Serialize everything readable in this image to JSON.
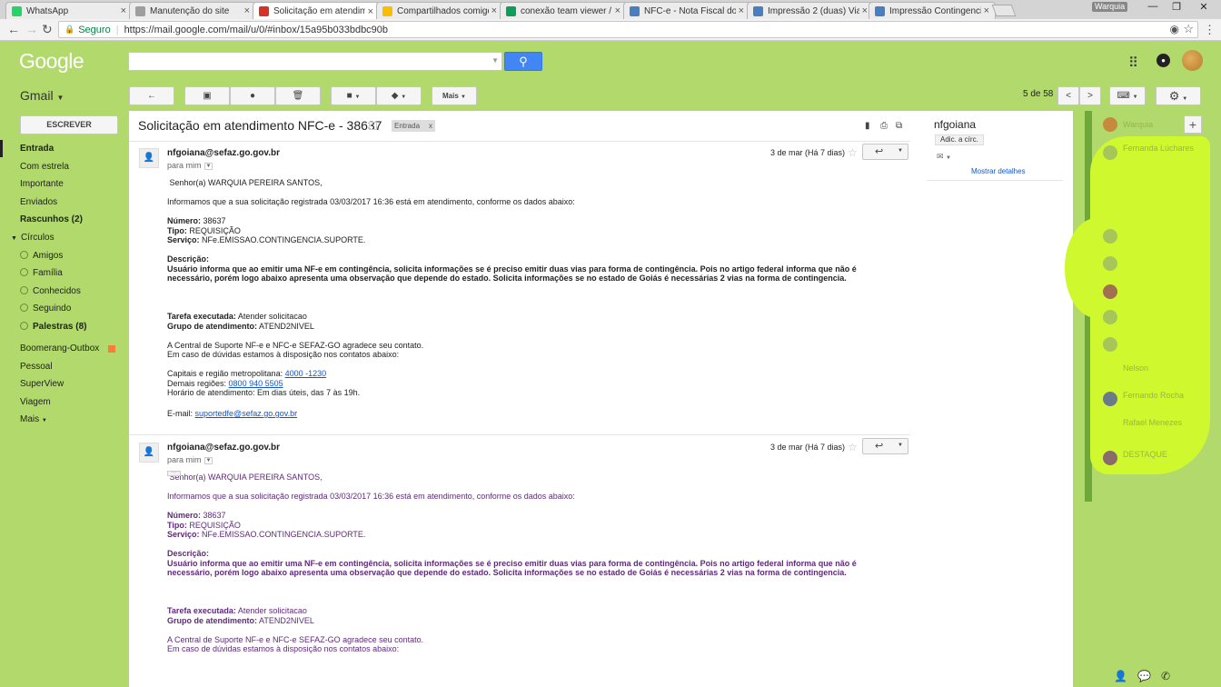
{
  "browser": {
    "tabs": [
      {
        "title": "WhatsApp",
        "color": "#25d366"
      },
      {
        "title": "Manutenção do site",
        "color": "#9e9e9e"
      },
      {
        "title": "Solicitação em atendime",
        "color": "#d93025"
      },
      {
        "title": "Compartilhados comigo",
        "color": "#fbbc05"
      },
      {
        "title": "conexão team viewer / c",
        "color": "#0f9d58"
      },
      {
        "title": "NFC-e - Nota Fiscal do C",
        "color": "#4a7fbf"
      },
      {
        "title": "Impressão 2 (duas) Vias",
        "color": "#4a7fbf"
      },
      {
        "title": "Impressão Contingencia",
        "color": "#4a7fbf"
      }
    ],
    "close_glyph": "×",
    "window_user": "Warquia",
    "secure_label": "Seguro",
    "url": "https://mail.google.com/mail/u/0/#inbox/15a95b033bdbc90b"
  },
  "header": {
    "logo": "Google",
    "product": "Gmail",
    "more_label": "Mais",
    "page_count": "5 de 58"
  },
  "sidebar": {
    "compose": "ESCREVER",
    "items": [
      {
        "label": "Entrada",
        "bold": true
      },
      {
        "label": "Com estrela"
      },
      {
        "label": "Importante"
      },
      {
        "label": "Enviados"
      },
      {
        "label": "Rascunhos (2)",
        "bold": true
      },
      {
        "label": "Círculos"
      },
      {
        "label": "Amigos",
        "circle": true
      },
      {
        "label": "Família",
        "circle": true
      },
      {
        "label": "Conhecidos",
        "circle": true
      },
      {
        "label": "Seguindo",
        "circle": true
      },
      {
        "label": "Palestras (8)",
        "circle": true,
        "bold": true
      },
      {
        "label": "Boomerang-Outbox",
        "badge": "#f87c3a"
      },
      {
        "label": "Pessoal"
      },
      {
        "label": "SuperView"
      },
      {
        "label": "Viagem"
      },
      {
        "label": "Mais"
      }
    ]
  },
  "thread": {
    "subject": "Solicitação em atendimento NFC-e - 38637",
    "label": "Entrada",
    "label_close": "x",
    "messages": [
      {
        "from": "nfgoiana@sefaz.go.gov.br",
        "to": "para mim",
        "date": "3 de mar (Há 7 dias)"
      },
      {
        "from": "nfgoiana@sefaz.go.gov.br",
        "to": "para mim",
        "date": "3 de mar (Há 7 dias)"
      }
    ],
    "body": {
      "greeting": "Senhor(a) WARQUIA PEREIRA SANTOS,",
      "intro": "Informamos que a sua solicitação registrada 03/03/2017 16:36 está em atendimento, conforme os dados abaixo:",
      "numero_label": "Número:",
      "numero": "38637",
      "tipo_label": "Tipo:",
      "tipo": "REQUISIÇÃO",
      "servico_label": "Serviço:",
      "servico": "NFe.EMISSAO.CONTINGENCIA.SUPORTE.",
      "descricao_label": "Descrição:",
      "descricao_1": "Usuário informa que ao emitir uma NF-e em contingência, solicita informações se é preciso emitir duas vias para forma de contingência. Pois no artigo federal informa que não é",
      "descricao_2": "necessário, porém logo abaixo apresenta uma observação que depende do estado. Solicita informações se no estado de Goiás é necessárias 2 vias na forma de contingencia.",
      "tarefa_label": "Tarefa executada:",
      "tarefa": "Atender solicitacao",
      "grupo_label": "Grupo de atendimento:",
      "grupo": "ATEND2NIVEL",
      "thanks": "A Central de Suporte NF-e e NFC-e SEFAZ-GO agradece seu contato.",
      "doubts": "Em caso de dúvidas estamos à disposição nos contatos abaixo:",
      "capitais_label": "Capitais e região metropolitana:",
      "capitais": "4000 -1230",
      "demais_label": "Demais regiões:",
      "demais": "0800 940 5505",
      "horario": "Horário de atendimento: Em dias úteis, das 7 às 19h.",
      "email_label": "E-mail:",
      "email": "suportedfe@sefaz.go.gov.br"
    }
  },
  "contact_panel": {
    "name": "nfgoiana",
    "add_button": "Adic. a círc.",
    "show_details": "Mostrar detalhes"
  },
  "chat": {
    "names": [
      "Warquia",
      "Fernanda Lúchares",
      "",
      "",
      "",
      "",
      "",
      "",
      "Nelson",
      "Fernando Rocha",
      "Rafael Menezes",
      "DESTAQUE"
    ]
  }
}
